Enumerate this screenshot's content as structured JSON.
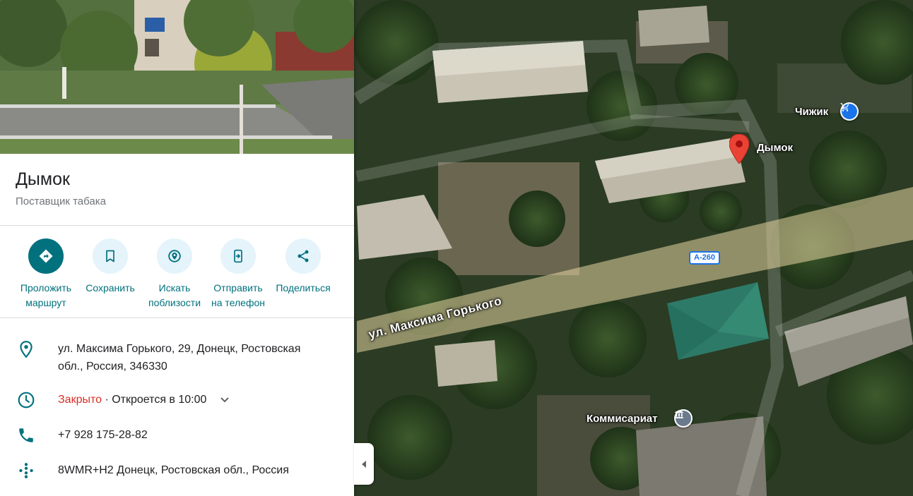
{
  "place": {
    "name": "Дымок",
    "category": "Поставщик табака"
  },
  "actions": [
    {
      "line1": "Проложить",
      "line2": "маршрут",
      "icon": "directions-icon",
      "primary": true
    },
    {
      "line1": "Сохранить",
      "line2": "",
      "icon": "bookmark-icon",
      "primary": false
    },
    {
      "line1": "Искать",
      "line2": "поблизости",
      "icon": "nearby-icon",
      "primary": false
    },
    {
      "line1": "Отправить",
      "line2": "на телефон",
      "icon": "send-to-phone-icon",
      "primary": false
    },
    {
      "line1": "Поделиться",
      "line2": "",
      "icon": "share-icon",
      "primary": false
    }
  ],
  "info": {
    "address_line1": "ул. Максима Горького, 29, Донецк, Ростовская",
    "address_line2": "обл., Россия, 346330",
    "hours_status": "Закрыто",
    "hours_next": " · Откроется в 10:00",
    "phone": "+7 928 175-28-82",
    "plus_code": "8WMR+H2 Донецк, Ростовская обл., Россия"
  },
  "map": {
    "pin_label": "Дымок",
    "poi_chizhik": "Чижик",
    "poi_commissariat": "Коммисариат",
    "road_shield": "А-260",
    "street_name": "ул. Максима Горького"
  },
  "colors": {
    "accent": "#00717d",
    "accent_light": "#e5f3fa",
    "closed": "#d93025",
    "pin": "#ea4335",
    "shop_poi": "#1a73e8"
  }
}
